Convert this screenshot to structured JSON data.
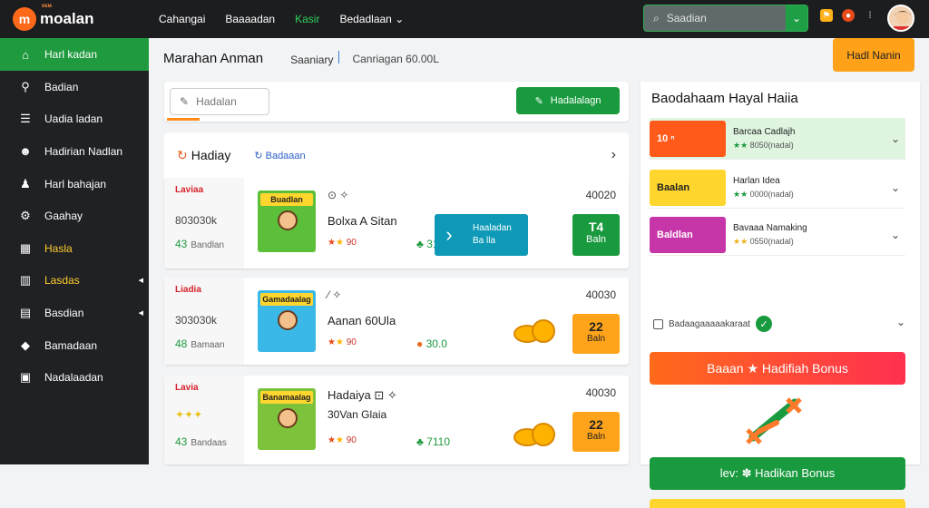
{
  "brand": {
    "small": "ᴅᴇᴍ",
    "name": "moalan",
    "mark": "m"
  },
  "topnav": [
    "Cahangai",
    "Baaaadan",
    "Kasir",
    "Bedadlaan"
  ],
  "search": {
    "placeholder": "Saadian"
  },
  "sidebar": {
    "items": [
      {
        "label": "Harl kadan",
        "icon": "home-icon",
        "active": true
      },
      {
        "label": "Badian",
        "icon": "search-icon"
      },
      {
        "label": "Uadia ladan",
        "icon": "list-icon"
      },
      {
        "label": "Hadirian Nadlan",
        "icon": "user-icon"
      },
      {
        "label": "Harl bahajan",
        "icon": "person-icon"
      },
      {
        "label": "Gaahay",
        "icon": "settings-icon"
      },
      {
        "label": "Hasla",
        "icon": "table-icon",
        "yellow": true
      },
      {
        "label": "Lasdas",
        "icon": "grid-icon",
        "yellow": true
      },
      {
        "label": "Basdian",
        "icon": "archive-icon"
      },
      {
        "label": "Bamadaan",
        "icon": "chat-icon"
      },
      {
        "label": "Nadalaadan",
        "icon": "mail-icon"
      }
    ]
  },
  "page": {
    "title": "Marahan Anman",
    "crumb1": "Saaniary",
    "crumb2": "Canriagan 60.00L"
  },
  "filter": {
    "placeholder": "Hadalan",
    "button": "Hadalalagn"
  },
  "list": {
    "tab1": "Hadiay",
    "tab2": "Badaaan"
  },
  "cards": [
    {
      "red": "Laviaa",
      "mid": "803030k",
      "foot": "43",
      "foot_small": "Bandlan",
      "title": "Bolxa A Sitan",
      "thumb_title": "Buadlan",
      "stars_text": "90",
      "price": "3100",
      "num": "40020",
      "buy_top": "Haaladan",
      "buy_bottom": "Ba lla",
      "green_top": "T4",
      "green_bottom": "Baln"
    },
    {
      "red": "Liadia",
      "mid": "303030k",
      "foot": "48",
      "foot_small": "Bamaan",
      "title": "Aanan 60Ula",
      "thumb_title": "Gamadaalag",
      "stars_text": "90",
      "price": "30.0",
      "num": "40030",
      "or_top": "22",
      "or_bottom": "Baln"
    },
    {
      "red": "Lavia",
      "mid": "",
      "foot": "43",
      "foot_small": "Bandaas",
      "title": "Hadaiya",
      "title2": "30Van Glaia",
      "thumb_title": "Banamaalag",
      "stars_text": "90",
      "price": "7110",
      "num": "40030",
      "or_top": "22",
      "or_bottom": "Baln"
    }
  ],
  "right": {
    "top_button": "Hadl Nanin",
    "title": "Baodahaam Hayal Haiia",
    "items": [
      {
        "img": "10 ⁿ",
        "a": "Barcaa Cadlajh",
        "b": "8050(nadal)",
        "color": "#ff6a1a"
      },
      {
        "img": "Baalan",
        "a": "Harlan Idea",
        "b": "0000(nadal)",
        "color": "#ffd62e"
      },
      {
        "img": "Baldlan",
        "a": "Bavaaa Namaking",
        "b": "0550(nadal)",
        "color": "#c736a8"
      }
    ],
    "check": "Badaagaaaaakaraat",
    "bonus1": "Baaan ★ Hadifiah Bonus",
    "bonus2": "lev: ✽ Hadikan Bonus"
  }
}
